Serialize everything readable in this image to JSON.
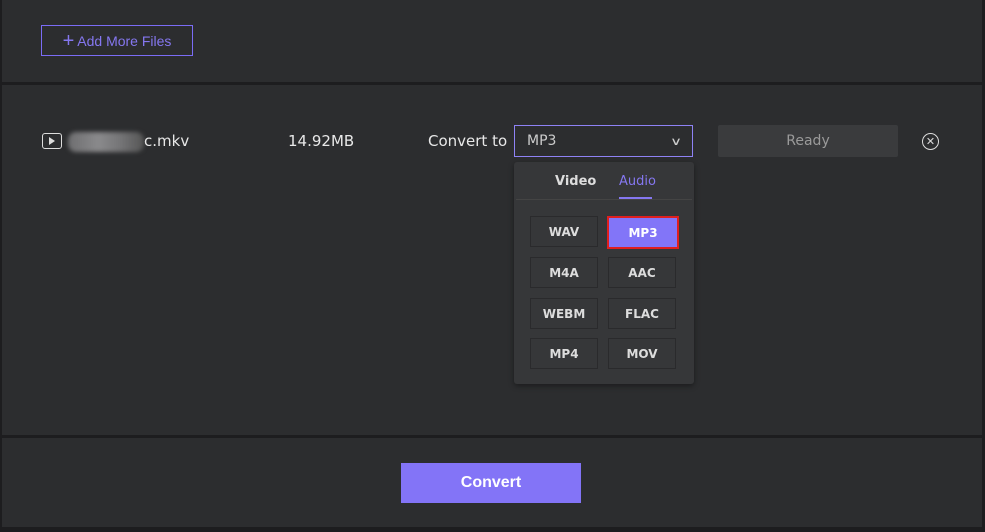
{
  "toolbar": {
    "add_more_files": "Add More Files"
  },
  "file": {
    "name_suffix": "c.mkv",
    "size": "14.92MB",
    "convert_to_label": "Convert to",
    "selected_format": "MP3",
    "status": "Ready"
  },
  "dropdown": {
    "tabs": [
      "Video",
      "Audio"
    ],
    "active_tab": "Audio",
    "formats": [
      "WAV",
      "MP3",
      "M4A",
      "AAC",
      "WEBM",
      "FLAC",
      "MP4",
      "MOV"
    ],
    "selected": "MP3"
  },
  "footer": {
    "convert": "Convert"
  },
  "colors": {
    "accent": "#8374f7",
    "highlight": "#e01f1f"
  }
}
